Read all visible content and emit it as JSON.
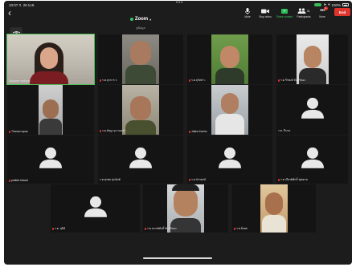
{
  "status_bar": {
    "time": "10:07 ก. 26 ม.ค.",
    "dots": "•••",
    "right": "100%"
  },
  "meeting": {
    "title": "Zoom",
    "subtitle": "ดูข้อมูล"
  },
  "toolbar": {
    "mute_label": "Mute",
    "video_label": "Stop video",
    "share_label": "Share content",
    "participants_label": "Participants",
    "participants_count": "31",
    "more_label": "More",
    "more_badge": "1",
    "end_label": "End"
  },
  "colors": {
    "accent_green": "#3cb95b",
    "end_red": "#e0332c",
    "tile_bg": "#141414",
    "active_speaker_border": "#4ec05a"
  },
  "tiles": [
    {
      "name": "Supavee sarkuno",
      "muted": false,
      "video": true,
      "active": true
    },
    {
      "name": "ร.ต.ธุรการ ร.",
      "muted": true,
      "video": true
    },
    {
      "name": "ร.ต.สุวิทย์ ร.",
      "muted": true,
      "video": true
    },
    {
      "name": "ร.ต.วีรพงษ์ จันทร์ทอง",
      "muted": true,
      "video": true
    },
    {
      "name": "Thanan mpas",
      "muted": true,
      "video": true
    },
    {
      "name": "ร.ต.อัษฎาวุธ ทองคำ",
      "muted": true,
      "video": true
    },
    {
      "name": "Jakka Kaeho",
      "muted": true,
      "video": true
    },
    {
      "name": "ร.ต. จีระพ.",
      "muted": false,
      "video": false
    },
    {
      "name": "pattida hlawal",
      "muted": true,
      "video": false
    },
    {
      "name": "ร.ต.สุรพล อุ่นจิตต์",
      "muted": false,
      "video": false
    },
    {
      "name": "ร.ต.จักรพงษ์",
      "muted": true,
      "video": false
    },
    {
      "name": "ร.ต.เกียรติศักดิ์ พุฒคาย",
      "muted": true,
      "video": false
    },
    {
      "name": "ร.ต. สุนีย์",
      "muted": true,
      "video": false
    },
    {
      "name": "ร.ต.ณรงค์ศักดิ์ อินทร์ทอง",
      "muted": true,
      "video": true
    },
    {
      "name": "ร.ต.ยิ่งยศ",
      "muted": true,
      "video": true
    }
  ],
  "icons": {
    "back": "chevron-left-icon",
    "mute": "microphone-icon",
    "video": "video-camera-icon",
    "share": "share-screen-icon",
    "participants": "participants-icon",
    "more": "more-dots-icon",
    "switch_camera": "switch-camera-icon",
    "self_view": "self-view-icon",
    "no_video": "person-silhouette-icon"
  }
}
